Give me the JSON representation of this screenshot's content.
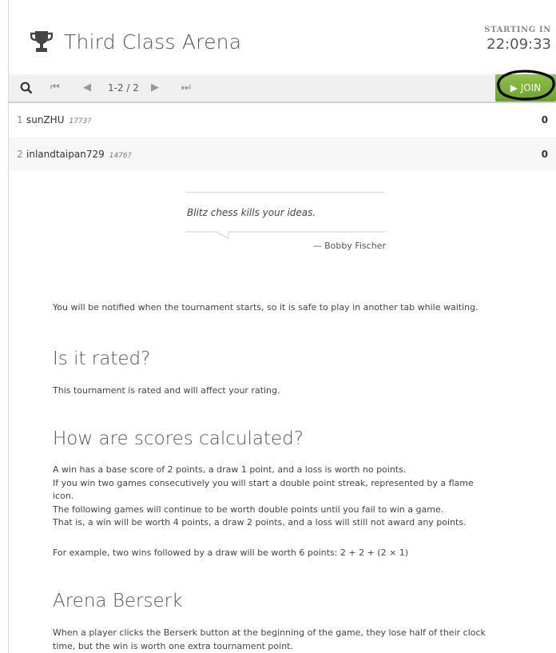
{
  "header": {
    "title": "Third Class Arena",
    "starting_label": "STARTING IN",
    "countdown": "22:09:33"
  },
  "pager": {
    "range": "1-2 / 2",
    "join_label": "▶ JOIN",
    "icons": [
      "search-icon",
      "first-page-icon",
      "prev-page-icon",
      "next-page-icon",
      "last-page-icon"
    ]
  },
  "standings": [
    {
      "rank": "1",
      "name": "sunZHU",
      "rating": "1773?",
      "score": "0"
    },
    {
      "rank": "2",
      "name": "inlandtaipan729",
      "rating": "1476?",
      "score": "0"
    }
  ],
  "quote": {
    "text": "Blitz chess kills your ideas.",
    "author": "— Bobby Fischer"
  },
  "faq": {
    "notify": "You will be notified when the tournament starts, so it is safe to play in another tab while waiting.",
    "rated_heading": "Is it rated?",
    "rated_text": "This tournament is rated and will affect your rating.",
    "scores_heading": "How are scores calculated?",
    "scores_line1": "A win has a base score of 2 points, a draw 1 point, and a loss is worth no points.",
    "scores_line2": "If you win two games consecutively you will start a double point streak, represented by a flame",
    "scores_line3": "icon.",
    "scores_line4": "The following games will continue to be worth double points until you fail to win a game.",
    "scores_line5": "That is, a win will be worth 4 points, a draw 2 points, and a loss will still not award any points.",
    "scores_example": "For example, two wins followed by a draw will be worth 6 points: 2 + 2 + (2 × 1)",
    "berserk_heading": "Arena Berserk",
    "berserk_line1": "When a player clicks the Berserk button at the beginning of the game, they lose half of their clock",
    "berserk_line2": "time, but the win is worth one extra tournament point."
  },
  "colors": {
    "join_green": "#7cb342",
    "annotation_circle": "#000000"
  }
}
